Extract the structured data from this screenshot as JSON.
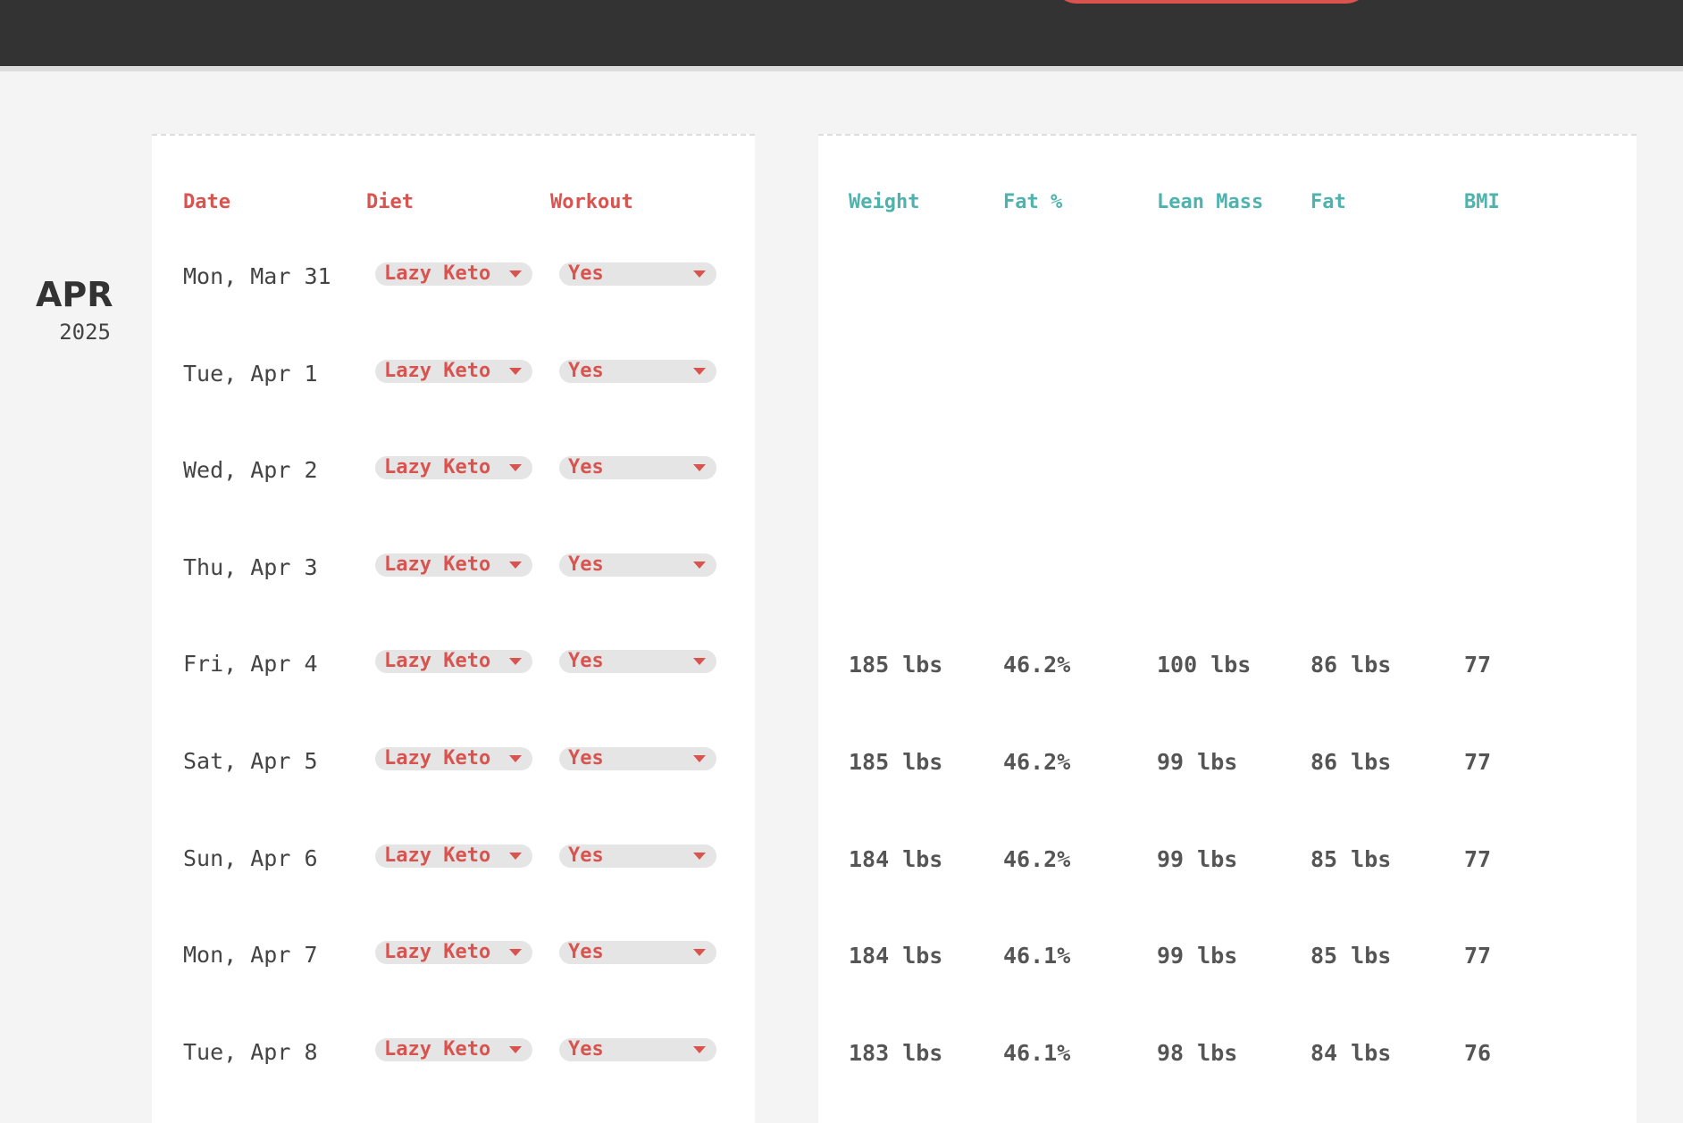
{
  "period": {
    "month": "APR",
    "year": "2025"
  },
  "left_headers": {
    "date": "Date",
    "diet": "Diet",
    "workout": "Workout"
  },
  "right_headers": {
    "weight": "Weight",
    "fat_pct": "Fat %",
    "lean_mass": "Lean Mass",
    "fat": "Fat",
    "bmi": "BMI"
  },
  "colors": {
    "accent_red": "#d9534f",
    "accent_teal": "#4fb3ad",
    "topbar": "#333333"
  },
  "rows": [
    {
      "date": "Mon, Mar 31",
      "diet": "Lazy Keto",
      "workout": "Yes",
      "weight": "",
      "fat_pct": "",
      "lean_mass": "",
      "fat": "",
      "bmi": ""
    },
    {
      "date": "Tue, Apr 1",
      "diet": "Lazy Keto",
      "workout": "Yes",
      "weight": "",
      "fat_pct": "",
      "lean_mass": "",
      "fat": "",
      "bmi": ""
    },
    {
      "date": "Wed, Apr 2",
      "diet": "Lazy Keto",
      "workout": "Yes",
      "weight": "",
      "fat_pct": "",
      "lean_mass": "",
      "fat": "",
      "bmi": ""
    },
    {
      "date": "Thu, Apr 3",
      "diet": "Lazy Keto",
      "workout": "Yes",
      "weight": "",
      "fat_pct": "",
      "lean_mass": "",
      "fat": "",
      "bmi": ""
    },
    {
      "date": "Fri, Apr 4",
      "diet": "Lazy Keto",
      "workout": "Yes",
      "weight": "185 lbs",
      "fat_pct": "46.2%",
      "lean_mass": "100 lbs",
      "fat": "86 lbs",
      "bmi": "77"
    },
    {
      "date": "Sat, Apr 5",
      "diet": "Lazy Keto",
      "workout": "Yes",
      "weight": "185 lbs",
      "fat_pct": "46.2%",
      "lean_mass": "99 lbs",
      "fat": "86 lbs",
      "bmi": "77"
    },
    {
      "date": "Sun, Apr 6",
      "diet": "Lazy Keto",
      "workout": "Yes",
      "weight": "184 lbs",
      "fat_pct": "46.2%",
      "lean_mass": "99 lbs",
      "fat": "85 lbs",
      "bmi": "77"
    },
    {
      "date": "Mon, Apr 7",
      "diet": "Lazy Keto",
      "workout": "Yes",
      "weight": "184 lbs",
      "fat_pct": "46.1%",
      "lean_mass": "99 lbs",
      "fat": "85 lbs",
      "bmi": "77"
    },
    {
      "date": "Tue, Apr 8",
      "diet": "Lazy Keto",
      "workout": "Yes",
      "weight": "183 lbs",
      "fat_pct": "46.1%",
      "lean_mass": "98 lbs",
      "fat": "84 lbs",
      "bmi": "76"
    }
  ]
}
